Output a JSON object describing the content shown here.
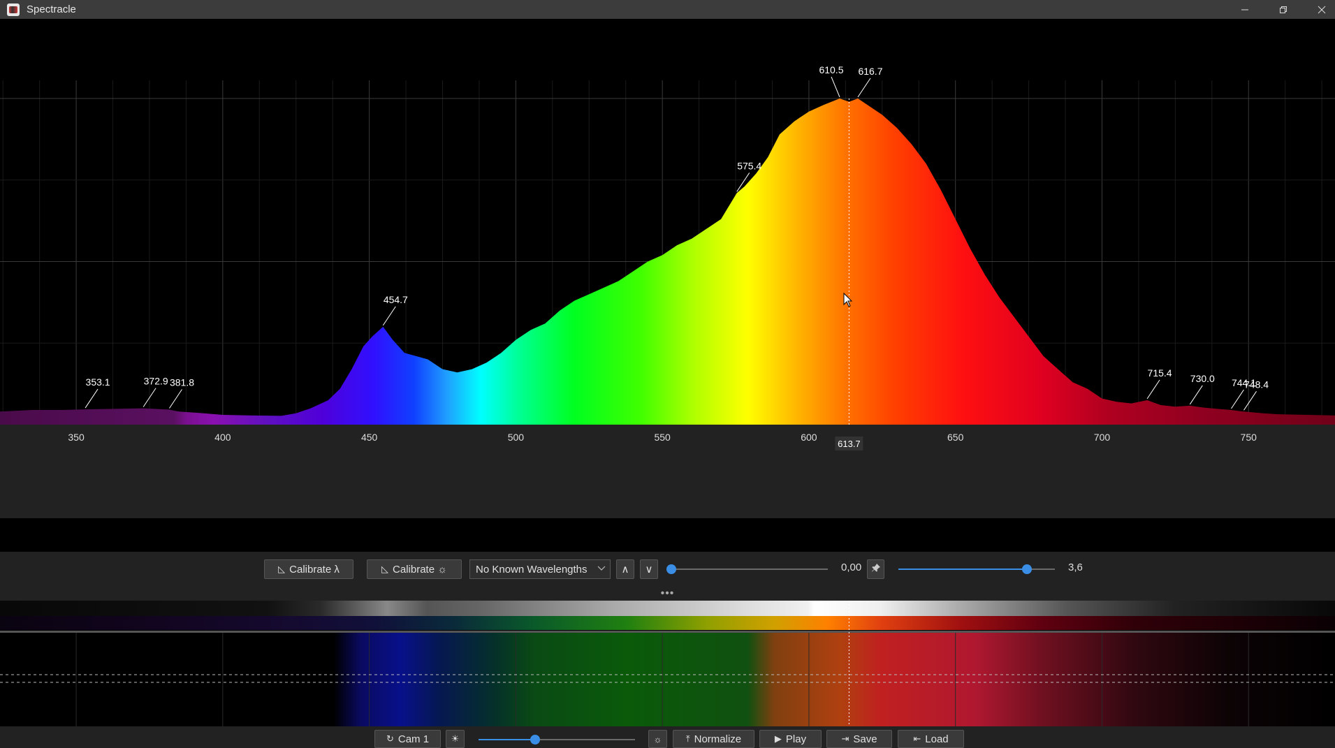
{
  "window": {
    "title": "Spectracle",
    "minimize_icon": "minimize-icon",
    "maximize_icon": "restore-icon",
    "close_icon": "close-icon"
  },
  "chart_data": {
    "type": "area",
    "xlabel": "",
    "ylabel": "",
    "xlim": [
      324.0,
      779.5
    ],
    "x_ticks": [
      350,
      400,
      450,
      500,
      550,
      600,
      650,
      700,
      750
    ],
    "series": [
      {
        "x": [
          324,
          335,
          345,
          353.1,
          360,
          372.9,
          381.8,
          385,
          392,
          400,
          410,
          420,
          425,
          430,
          436,
          440,
          444,
          448,
          451,
          454.7,
          458,
          462,
          466,
          470,
          475,
          480,
          485,
          490,
          495,
          500,
          505,
          510,
          515,
          520,
          525,
          530,
          535,
          540,
          545,
          550,
          555,
          560,
          565,
          570,
          575.4,
          578,
          582,
          586,
          590,
          595,
          600,
          605,
          610.5,
          613.7,
          616.7,
          620,
          625,
          630,
          635,
          640,
          645,
          650,
          655,
          660,
          665,
          670,
          675,
          680,
          685,
          690,
          695,
          700,
          705,
          710,
          715.4,
          720,
          725,
          730,
          735,
          740,
          744.1,
          748.4,
          755,
          760,
          770,
          779.5
        ],
        "y": [
          0.04,
          0.045,
          0.045,
          0.047,
          0.048,
          0.05,
          0.046,
          0.04,
          0.036,
          0.03,
          0.028,
          0.027,
          0.035,
          0.05,
          0.075,
          0.11,
          0.17,
          0.24,
          0.27,
          0.3,
          0.26,
          0.22,
          0.21,
          0.2,
          0.17,
          0.16,
          0.17,
          0.19,
          0.22,
          0.26,
          0.29,
          0.31,
          0.35,
          0.38,
          0.4,
          0.42,
          0.44,
          0.47,
          0.5,
          0.52,
          0.55,
          0.57,
          0.6,
          0.63,
          0.71,
          0.73,
          0.77,
          0.82,
          0.89,
          0.93,
          0.96,
          0.98,
          1.0,
          0.99,
          1.0,
          0.98,
          0.95,
          0.91,
          0.86,
          0.8,
          0.72,
          0.63,
          0.54,
          0.46,
          0.39,
          0.33,
          0.27,
          0.21,
          0.17,
          0.13,
          0.11,
          0.08,
          0.07,
          0.065,
          0.075,
          0.06,
          0.055,
          0.058,
          0.052,
          0.048,
          0.045,
          0.04,
          0.035,
          0.032,
          0.03,
          0.028
        ]
      }
    ],
    "peak_labels": [
      "353.1",
      "372.9",
      "381.8",
      "454.7",
      "575.4",
      "610.5",
      "616.7",
      "715.4",
      "730.0",
      "744.1",
      "748.4"
    ],
    "peak_positions": [
      353.1,
      372.9,
      381.8,
      454.7,
      575.4,
      610.5,
      616.7,
      715.4,
      730.0,
      744.1,
      748.4
    ],
    "cursor_label": "613.7",
    "cursor_value": 613.7,
    "grid": true
  },
  "controls": {
    "calibrate_wavelength": "Calibrate λ",
    "calibrate_brightness": "Calibrate ☼",
    "known_wavelengths_select": "No Known Wavelengths",
    "up_button": "∧",
    "down_button": "∨",
    "smoothing_value": "0,00",
    "smoothing_level": 0.0,
    "gain_value": "3,6",
    "gain_level": 0.82,
    "pin_icon": "pin-icon",
    "divider_handle": "•••"
  },
  "bottom": {
    "camera_button": "Cam 1",
    "exposure_level": 0.36,
    "normalize_button": "Normalize",
    "play_button": "Play",
    "save_button": "Save",
    "load_button": "Load"
  }
}
